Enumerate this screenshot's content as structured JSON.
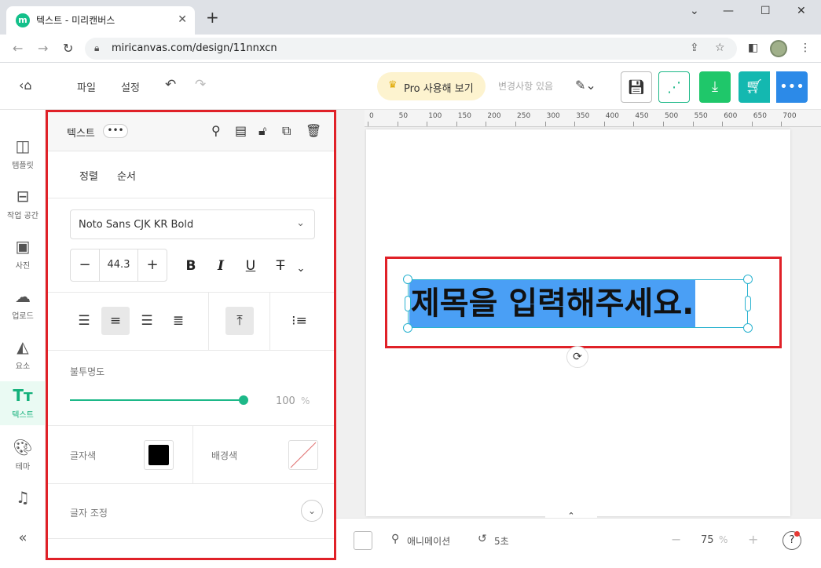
{
  "browser": {
    "tab_title": "텍스트 - 미리캔버스",
    "favicon_letter": "m",
    "url": "miricanvas.com/design/11nnxcn"
  },
  "toolbar": {
    "file": "파일",
    "settings": "설정",
    "pro_label": "Pro 사용해 보기",
    "changes": "변경사항 있음"
  },
  "rail": {
    "items": [
      {
        "label": "템플릿",
        "icon": "template-icon"
      },
      {
        "label": "작업 공간",
        "icon": "archive-icon"
      },
      {
        "label": "사진",
        "icon": "photo-icon"
      },
      {
        "label": "업로드",
        "icon": "upload-icon"
      },
      {
        "label": "요소",
        "icon": "shapes-icon"
      },
      {
        "label": "텍스트",
        "icon": "text-icon"
      },
      {
        "label": "테마",
        "icon": "palette-icon"
      },
      {
        "label": "",
        "icon": "music-icon"
      }
    ]
  },
  "panel": {
    "title": "텍스트",
    "more": "•••",
    "tabs": [
      "정렬",
      "순서"
    ],
    "font_name": "Noto Sans CJK KR Bold",
    "font_size": "44.3",
    "opacity_label": "불투명도",
    "opacity_value": "100",
    "opacity_unit": "%",
    "opacity_fraction": 1.0,
    "text_color_label": "글자색",
    "text_color": "#000000",
    "bg_color_label": "배경색",
    "adjust_label": "글자 조정"
  },
  "ruler": {
    "labels": [
      "0",
      "50",
      "100",
      "150",
      "200",
      "250",
      "300",
      "350",
      "400",
      "450",
      "500",
      "550",
      "600",
      "650",
      "700"
    ]
  },
  "canvas": {
    "text": "제목을 입력해주세요."
  },
  "bottom": {
    "animation": "애니메이션",
    "history": "5초",
    "zoom": "75",
    "zoom_unit": "%"
  },
  "colors": {
    "accent": "#1db888",
    "highlight": "#e02128",
    "selection": "#4a9ff5"
  }
}
